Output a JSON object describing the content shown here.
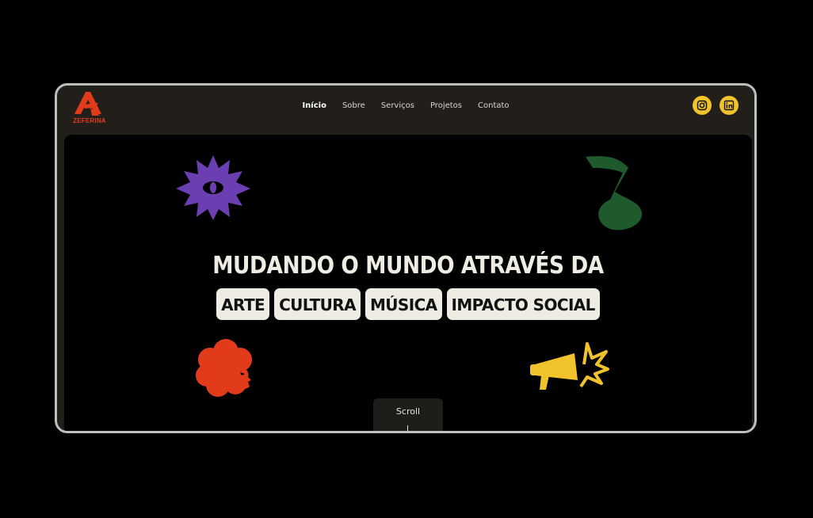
{
  "brand": {
    "name": "ZEFERINA",
    "color": "#e23b1b"
  },
  "nav": {
    "items": [
      {
        "label": "Início",
        "active": true
      },
      {
        "label": "Sobre",
        "active": false
      },
      {
        "label": "Serviços",
        "active": false
      },
      {
        "label": "Projetos",
        "active": false
      },
      {
        "label": "Contato",
        "active": false
      }
    ]
  },
  "social": {
    "instagram_icon": "instagram-icon",
    "linkedin_icon": "linkedin-icon",
    "color": "#f0c22b"
  },
  "hero": {
    "headline": "MUDANDO O MUNDO ATRAVÉS DA",
    "tags": [
      "ARTE",
      "CULTURA",
      "MÚSICA",
      "IMPACTO SOCIAL"
    ],
    "illustrations": {
      "eye_star": "#6b3fb2",
      "music_note": "#1f5a2c",
      "flower_head": "#e23b1b",
      "megaphone": "#f0c22b"
    }
  },
  "scroll": {
    "label": "Scroll"
  }
}
